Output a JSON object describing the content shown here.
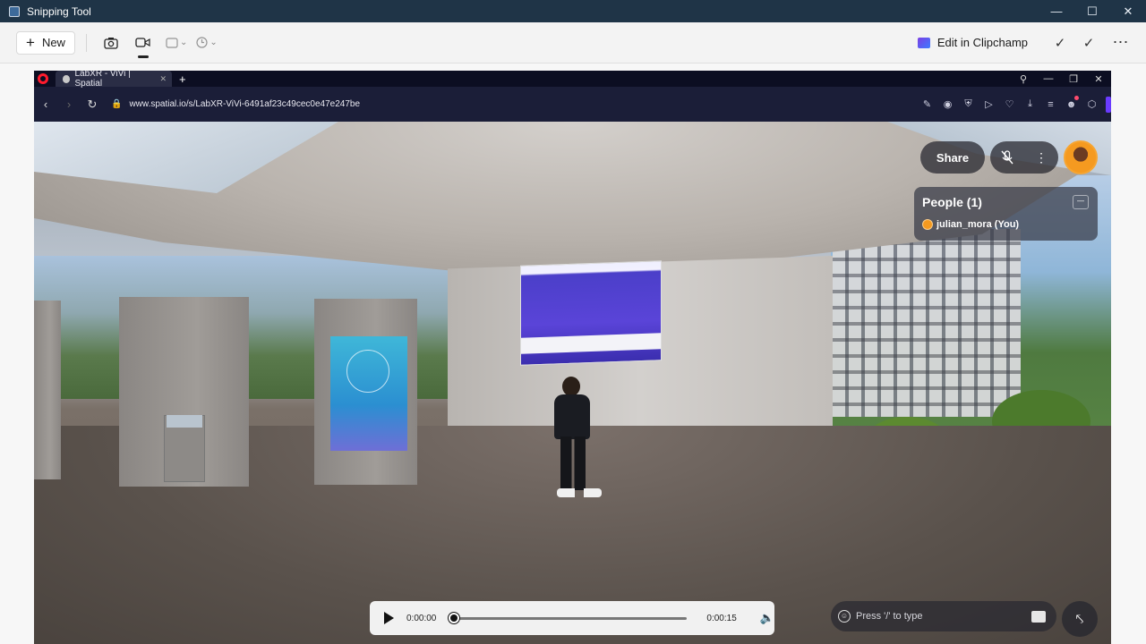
{
  "snipping_tool": {
    "title": "Snipping Tool",
    "new_label": "New",
    "clipchamp_label": "Edit in Clipchamp"
  },
  "browser": {
    "tab_title": "LabXR - ViVi | Spatial",
    "url": "www.spatial.io/s/LabXR-ViVi-6491af23c49cec0e47e247be"
  },
  "spatial": {
    "share_label": "Share",
    "people_title": "People (1)",
    "people_list": [
      "julian_mora (You)"
    ],
    "chat_placeholder": "Press '/' to type"
  },
  "media": {
    "current_time": "0:00:00",
    "total_time": "0:00:15",
    "progress": 0
  },
  "icons": {
    "screenshot": "camera-icon",
    "record": "video-icon",
    "mic": "mic-muted-icon"
  }
}
